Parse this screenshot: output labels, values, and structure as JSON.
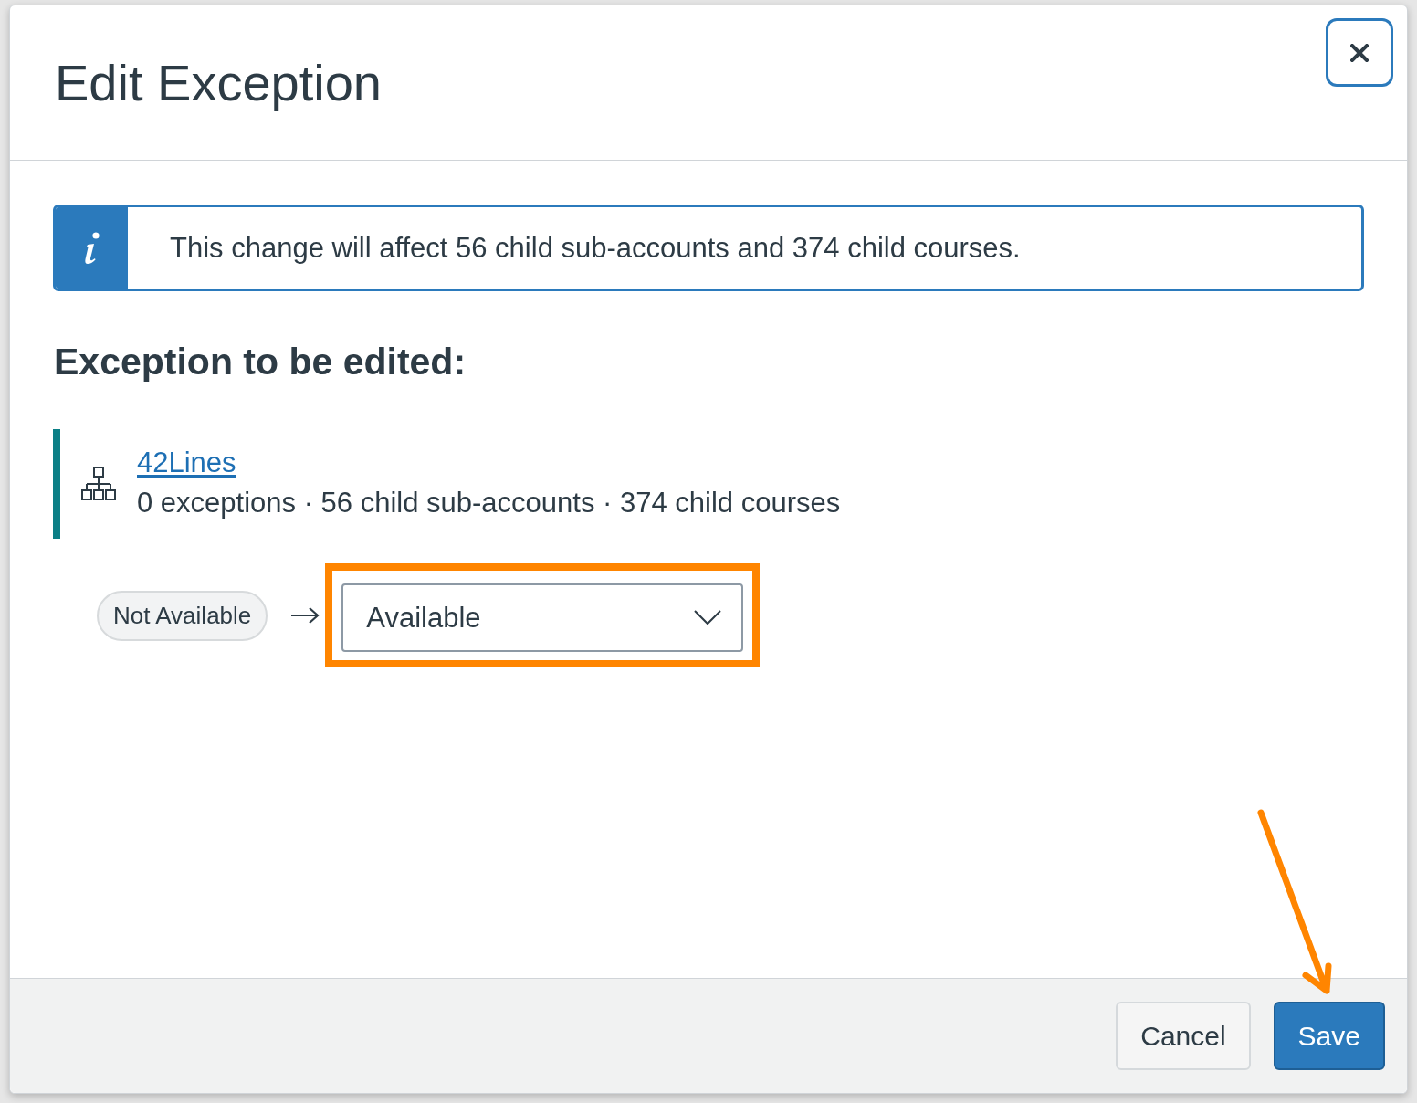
{
  "dialog": {
    "title": "Edit Exception"
  },
  "alert": {
    "kind": "info",
    "message": "This change will affect 56 child sub-accounts and 374 child courses."
  },
  "section_heading": "Exception to be edited:",
  "account": {
    "name": "42Lines",
    "details": "0 exceptions · 56 child sub-accounts · 374 child courses"
  },
  "change_row": {
    "current_status": "Not Available",
    "new_status_select": {
      "value": "Available"
    }
  },
  "footer": {
    "buttons": [
      {
        "label": "Cancel",
        "kind": "secondary"
      },
      {
        "label": "Save",
        "kind": "primary"
      }
    ]
  }
}
